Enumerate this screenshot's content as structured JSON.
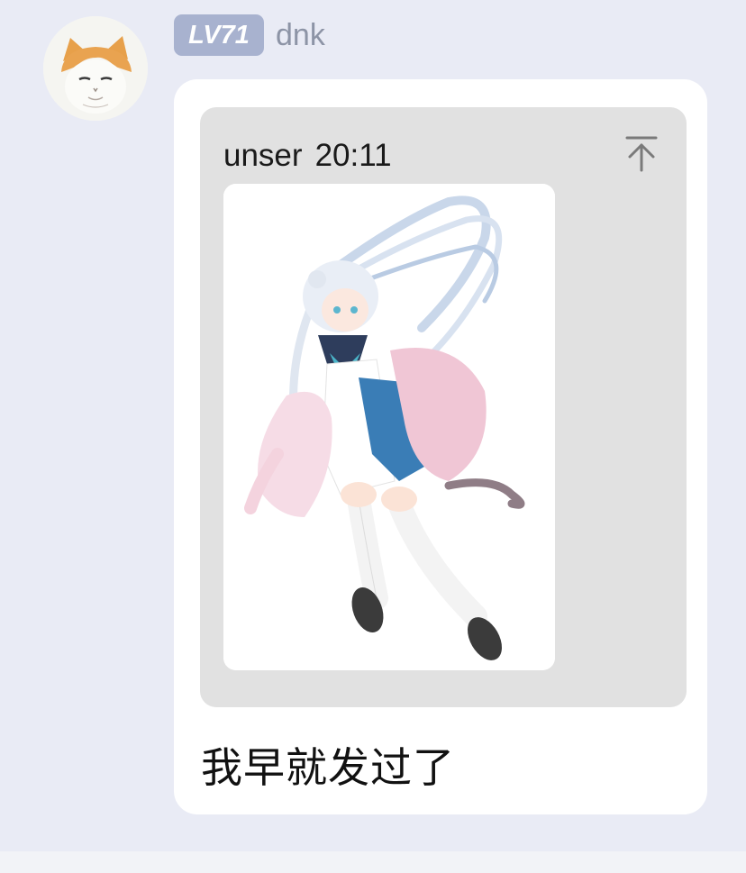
{
  "message": {
    "sender": {
      "level_badge": "LV71",
      "name": "dnk",
      "avatar_icon": "cat-avatar-icon"
    },
    "quote": {
      "author": "unser",
      "time": "20:11",
      "jump_icon": "jump-to-top-icon",
      "image_icon": "anime-girl-illustration"
    },
    "text": "我早就发过了"
  },
  "colors": {
    "background": "#e9ebf5",
    "bubble": "#ffffff",
    "quote_card": "#e1e1e1",
    "level_badge": "#a8b2cf",
    "username": "#8d94a6"
  }
}
